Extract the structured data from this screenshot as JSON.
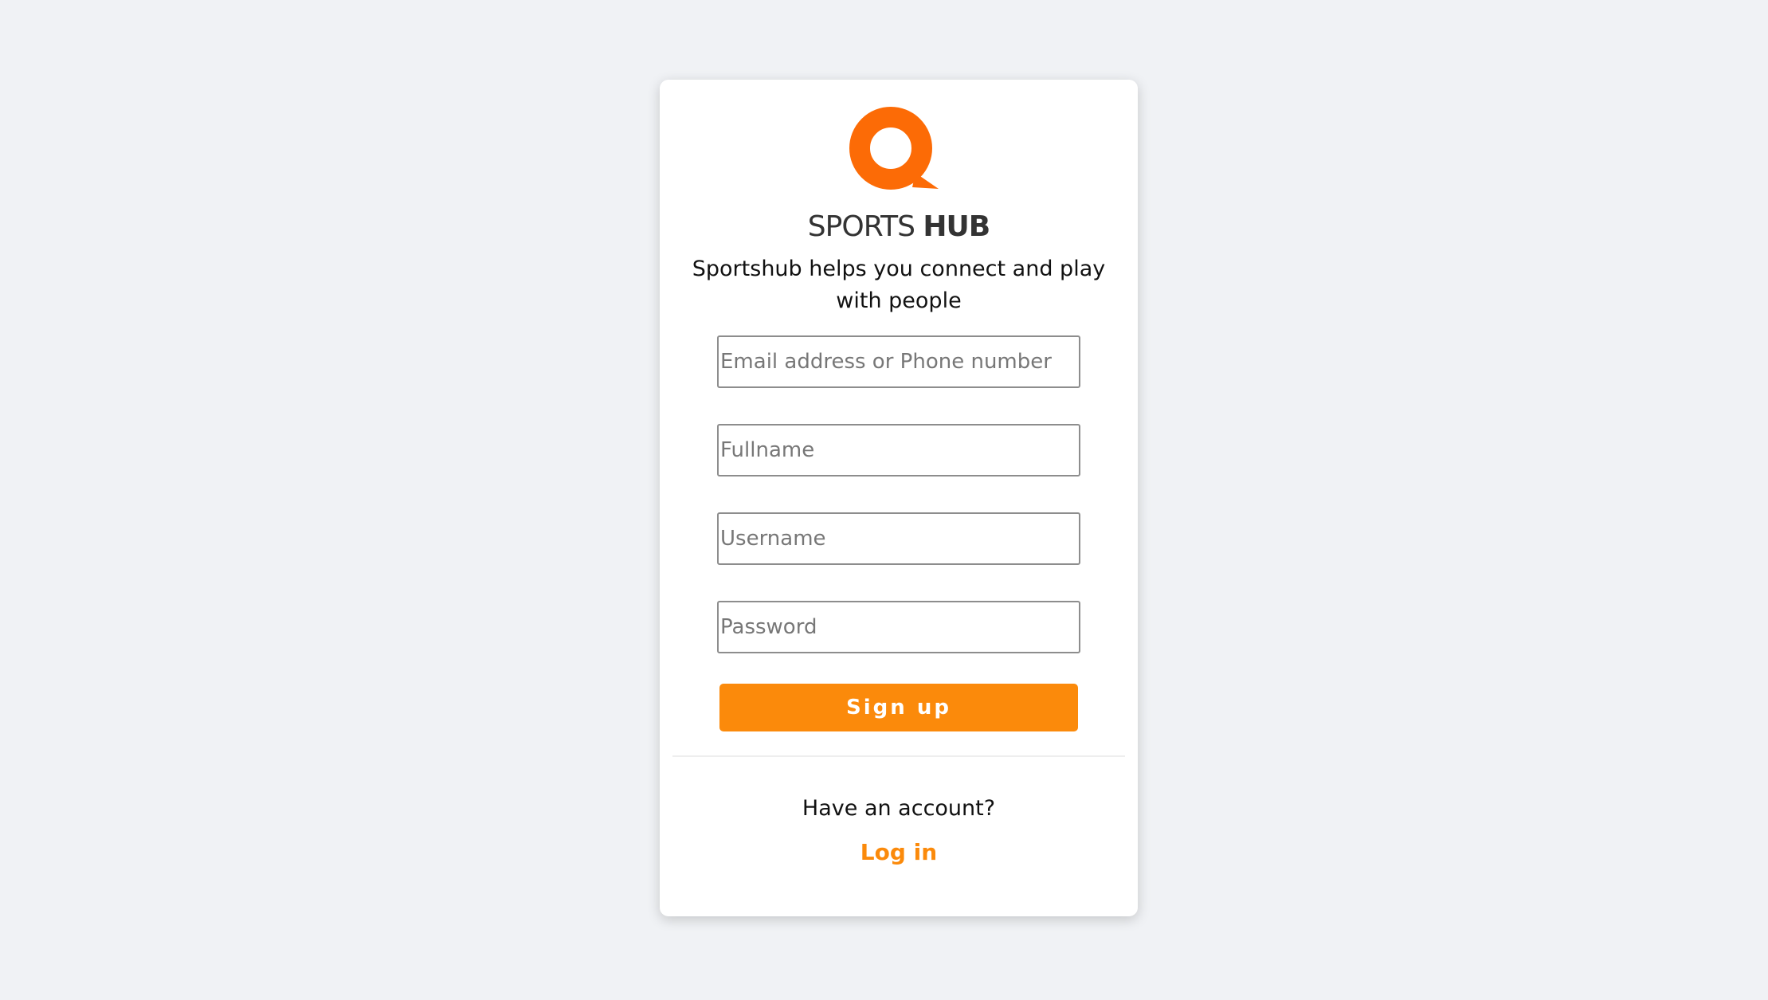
{
  "brand": {
    "logo_icon": "sportshub-logo-icon",
    "name_light": "SPORTS",
    "name_bold": "HUB",
    "accent_color": "#fb8a0b",
    "logo_color": "#fc6b06"
  },
  "tagline": "Sportshub helps you connect and play with people",
  "form": {
    "email": {
      "placeholder": "Email address or Phone number",
      "value": ""
    },
    "fullname": {
      "placeholder": "Fullname",
      "value": ""
    },
    "username": {
      "placeholder": "Username",
      "value": ""
    },
    "password": {
      "placeholder": "Password",
      "value": ""
    },
    "submit_label": "Sign up"
  },
  "footer": {
    "prompt": "Have an account?",
    "login_label": "Log in"
  }
}
